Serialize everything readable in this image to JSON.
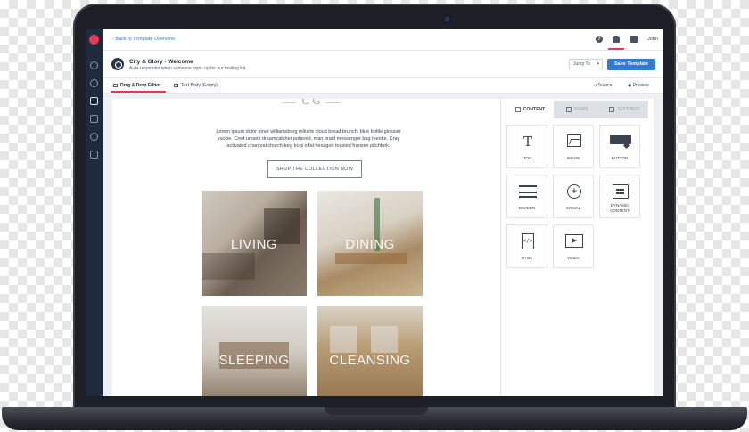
{
  "topbar": {
    "back_link": "Back to Template Overview",
    "user_name": "John"
  },
  "template": {
    "title": "City & Glory - Welcome",
    "subtitle": "Auto-responder when someone signs up for our mailing list",
    "jump_to": "Jump To",
    "save_label": "Save Template"
  },
  "tabs": {
    "drag_drop": "Drag & Drop Editor",
    "text_body": "Text Body (Empty)",
    "source": "Source",
    "preview": "Preview"
  },
  "email": {
    "logo": "C G",
    "body": "Lorem ipsum dolor amet williamsburg mlkshk cloud bread brunch, blue bottle glossier yuccie. Cred umami dreamcatcher polaroid, man braid messenger bag hoodie. Cray activated charcoal church-key, kogi offal hexagon tousled franzen pitchfork.",
    "cta": "SHOP THE COLLECTION NOW",
    "tiles": [
      "LIVING",
      "DINING",
      "SLEEPING",
      "CLEANSING"
    ]
  },
  "panel": {
    "tabs": [
      "CONTENT",
      "ROWS",
      "SETTINGS"
    ],
    "blocks": [
      "TEXT",
      "IMAGE",
      "BUTTON",
      "DIVIDER",
      "SOCIAL",
      "DYNAMIC CONTENT",
      "HTML",
      "VIDEO"
    ]
  },
  "colors": {
    "accent": "#2f7ad3",
    "highlight": "#e23a4e",
    "rail": "#1f2a3c"
  }
}
